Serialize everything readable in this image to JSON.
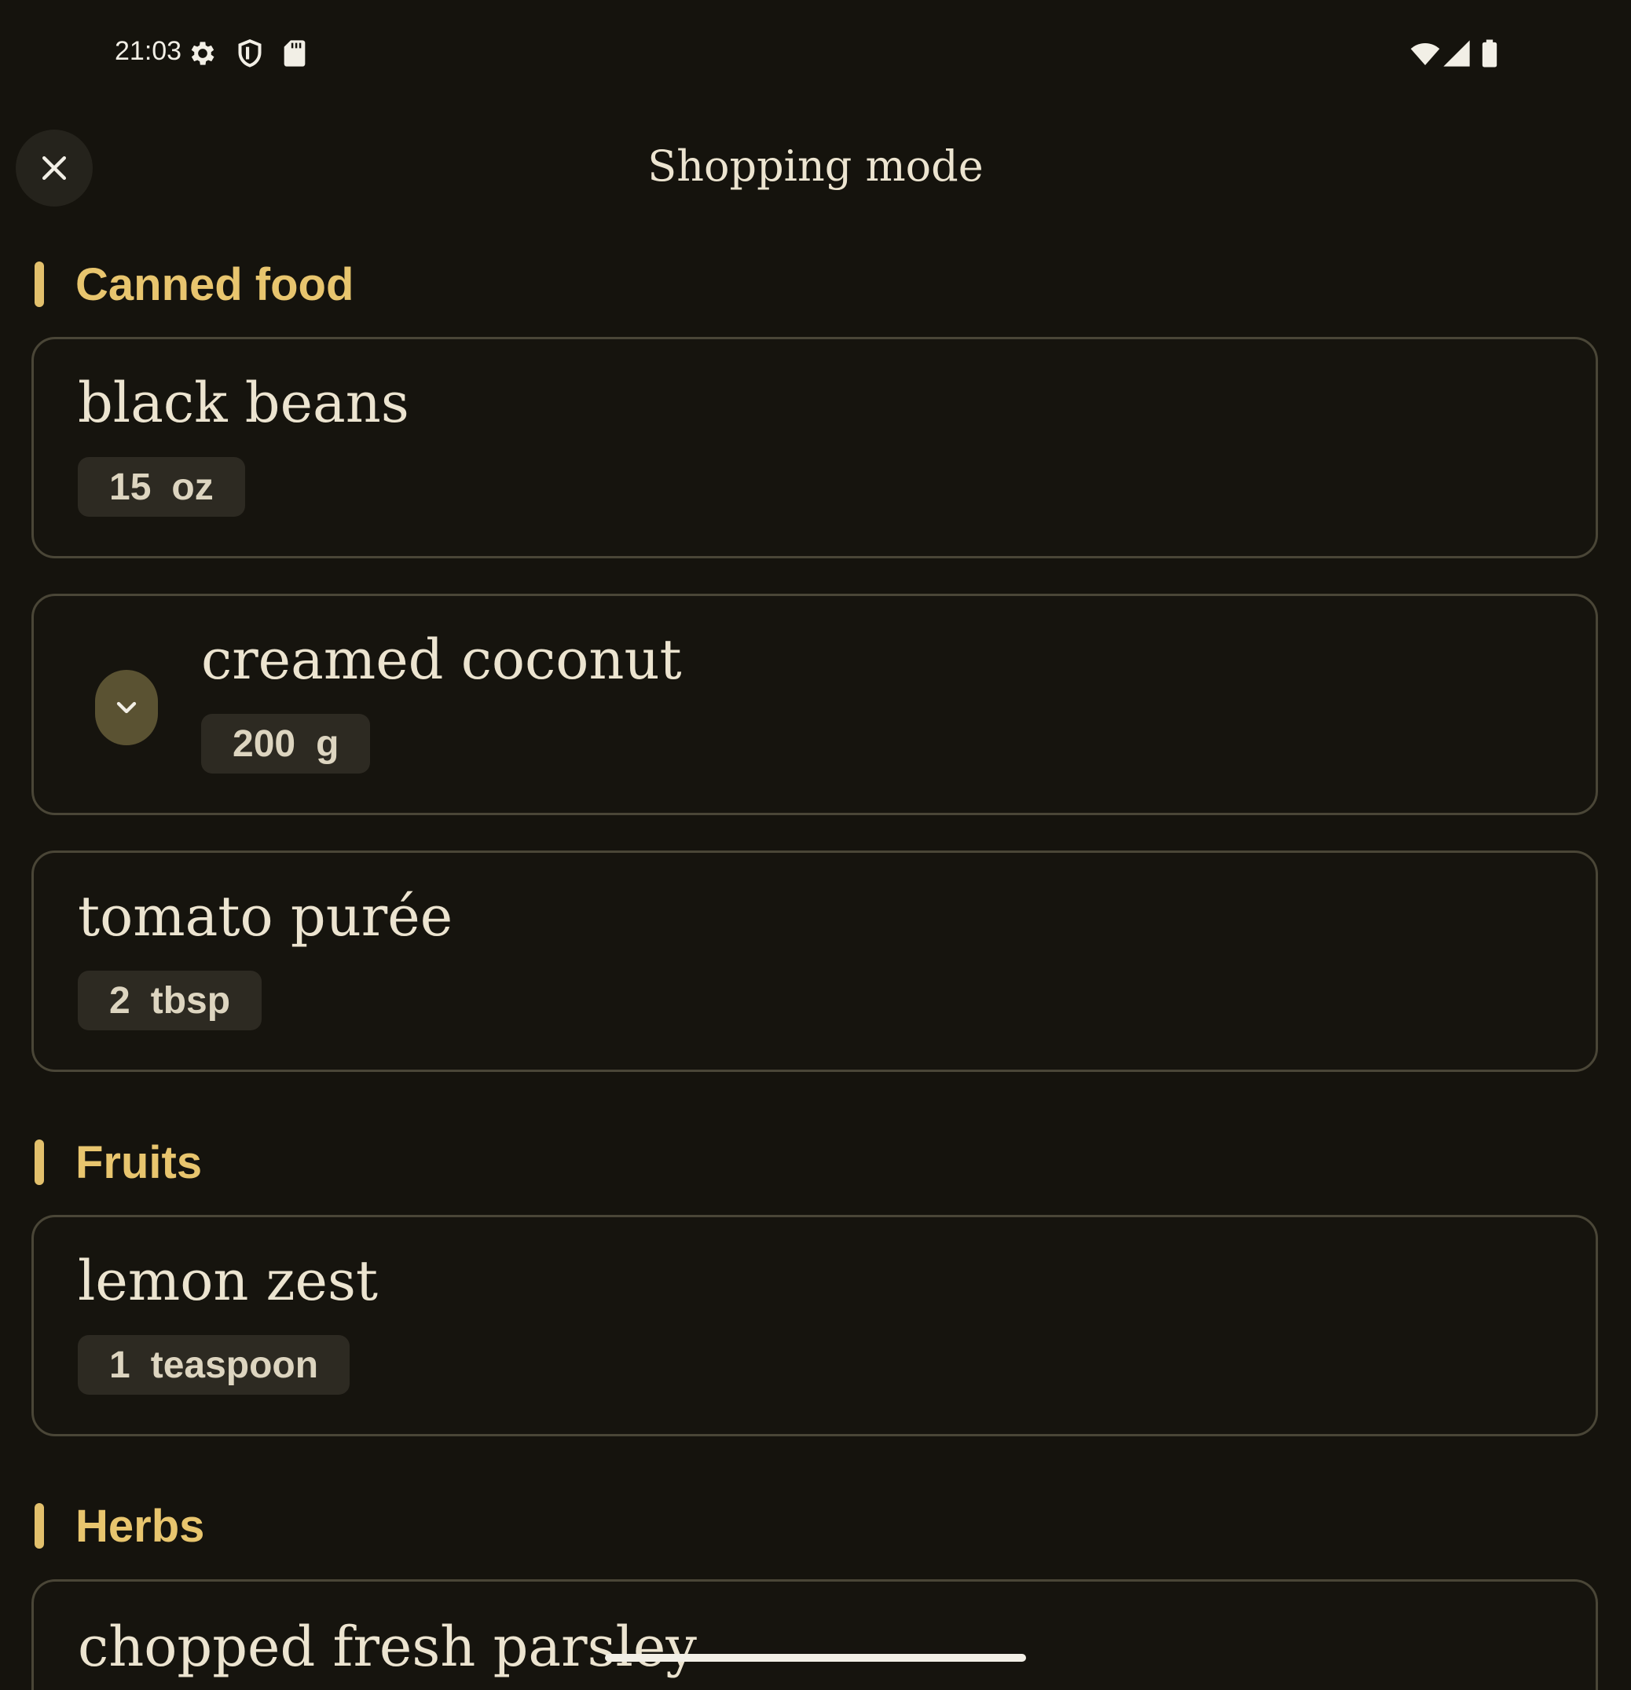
{
  "status_bar": {
    "time": "21:03",
    "left_icons": [
      "gear-icon",
      "shield-icon",
      "sd-card-icon"
    ],
    "right_icons": [
      "wifi-icon",
      "cellular-signal-icon",
      "battery-icon"
    ]
  },
  "header": {
    "title": "Shopping mode",
    "close_icon": "close-icon"
  },
  "colors": {
    "background": "#15130d",
    "accent": "#e8c56e",
    "card_border": "#4a4637",
    "chip_bg": "#2d2a22",
    "toggle_bg": "#5a5232"
  },
  "sections": [
    {
      "title": "Canned food",
      "items": [
        {
          "name": "black beans",
          "amount": "15",
          "unit": "oz"
        },
        {
          "name": "creamed coconut",
          "amount": "200",
          "unit": "g",
          "toggle_icon": "chevron-down-icon"
        },
        {
          "name": "tomato purée",
          "amount": "2",
          "unit": "tbsp"
        }
      ]
    },
    {
      "title": "Fruits",
      "items": [
        {
          "name": "lemon zest",
          "amount": "1",
          "unit": "teaspoon"
        }
      ]
    },
    {
      "title": "Herbs",
      "items": [
        {
          "name": "chopped fresh parsley"
        }
      ]
    }
  ]
}
